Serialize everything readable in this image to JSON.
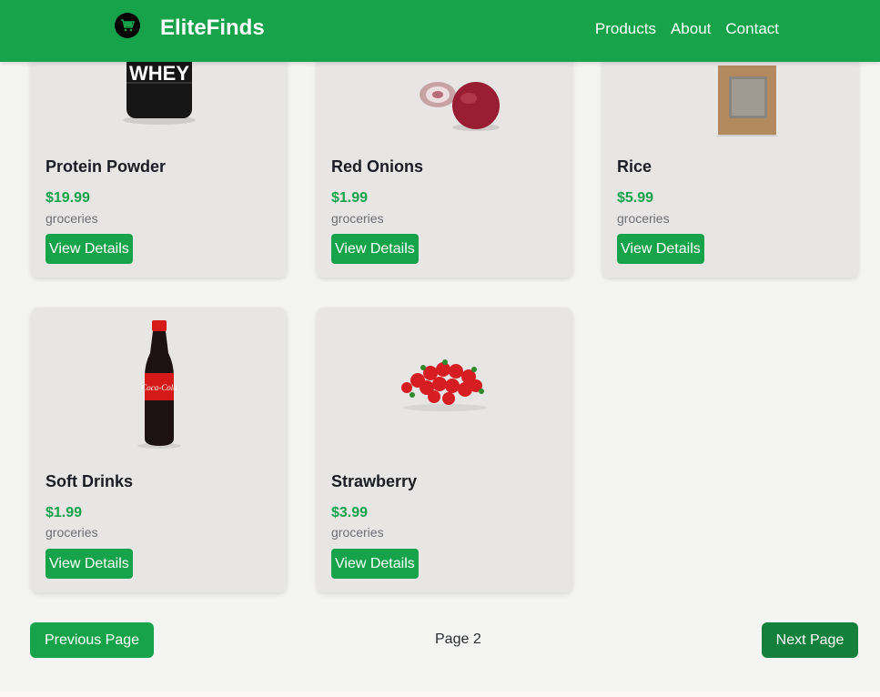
{
  "header": {
    "brand": "EliteFinds",
    "nav": [
      "Products",
      "About",
      "Contact"
    ]
  },
  "products": [
    {
      "title": "Protein Powder",
      "price": "$19.99",
      "category": "groceries",
      "button": "View Details"
    },
    {
      "title": "Red Onions",
      "price": "$1.99",
      "category": "groceries",
      "button": "View Details"
    },
    {
      "title": "Rice",
      "price": "$5.99",
      "category": "groceries",
      "button": "View Details"
    },
    {
      "title": "Soft Drinks",
      "price": "$1.99",
      "category": "groceries",
      "button": "View Details"
    },
    {
      "title": "Strawberry",
      "price": "$3.99",
      "category": "groceries",
      "button": "View Details"
    }
  ],
  "pagination": {
    "prev": "Previous Page",
    "page": "Page 2",
    "next": "Next Page"
  },
  "colors": {
    "brand_green": "#17a34a",
    "next_green": "#157f3c"
  }
}
